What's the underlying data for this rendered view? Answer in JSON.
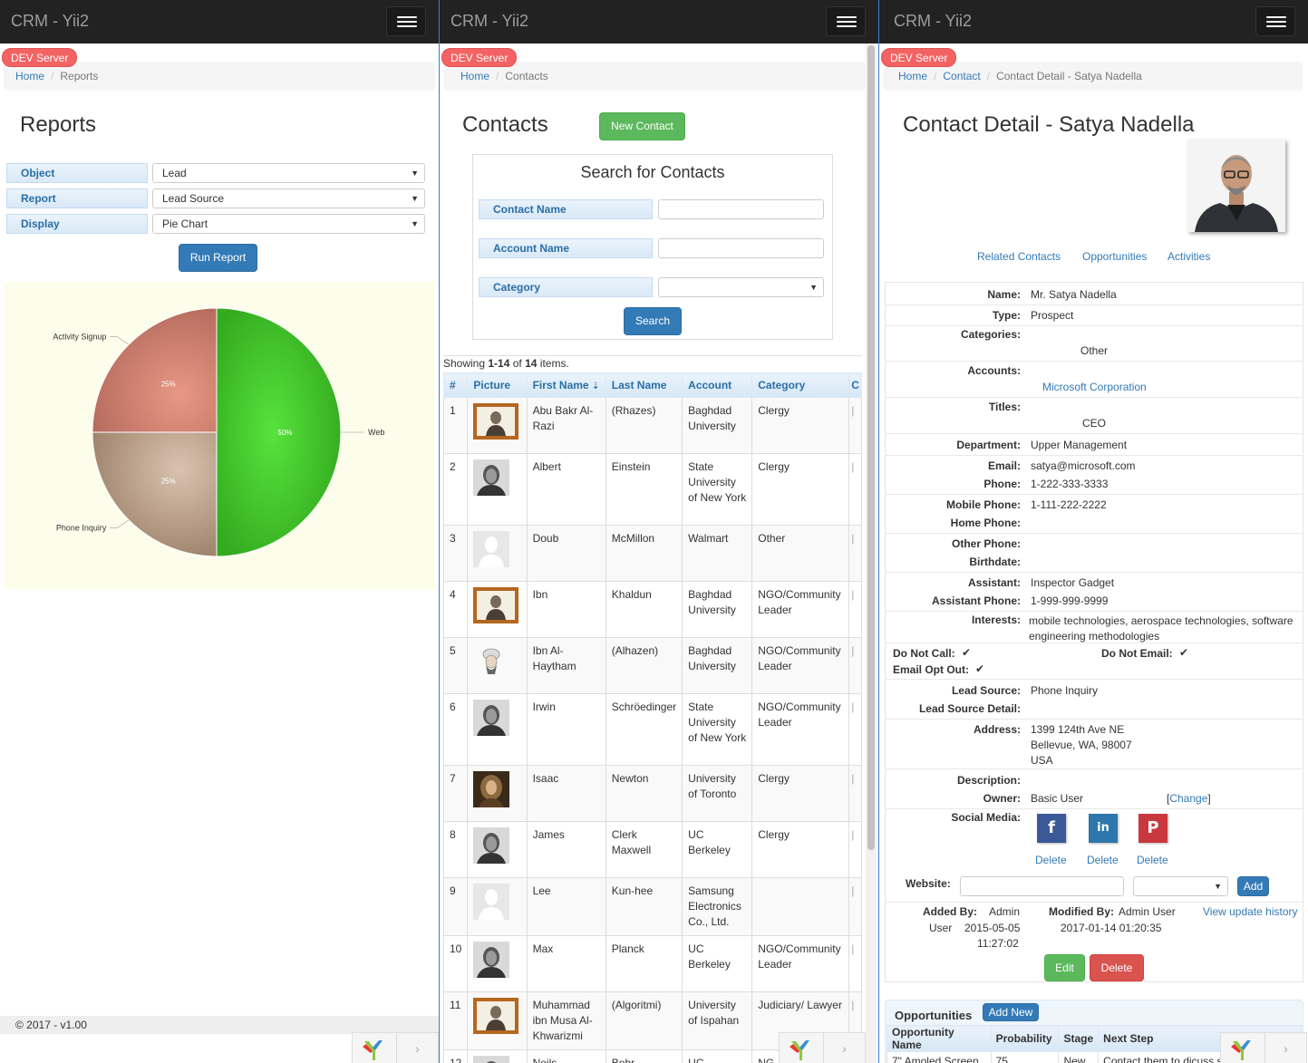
{
  "app_title": "CRM - Yii2",
  "dev_badge": "DEV  Server",
  "reports": {
    "breadcrumb": {
      "home": "Home",
      "current": "Reports"
    },
    "title": "Reports",
    "filters": [
      {
        "label": "Object",
        "value": "Lead"
      },
      {
        "label": "Report",
        "value": "Lead Source"
      },
      {
        "label": "Display",
        "value": "Pie Chart"
      }
    ],
    "run_button": "Run Report",
    "footer": "© 2017 - v1.00"
  },
  "chart_data": {
    "type": "pie",
    "title": "",
    "slices": [
      {
        "label": "Web",
        "value": 50,
        "display": "50%",
        "color": "#3cba2a"
      },
      {
        "label": "Phone Inquiry",
        "value": 25,
        "display": "25%",
        "color": "#b49c85"
      },
      {
        "label": "Activity Signup",
        "value": 25,
        "display": "25%",
        "color": "#c87b69"
      }
    ]
  },
  "contacts": {
    "breadcrumb": {
      "home": "Home",
      "current": "Contacts"
    },
    "title": "Contacts",
    "new_button": "New Contact",
    "search": {
      "title": "Search for Contacts",
      "fields": [
        "Contact Name",
        "Account Name",
        "Category"
      ],
      "button": "Search"
    },
    "summary": {
      "prefix": "Showing ",
      "range": "1-14",
      "mid": " of ",
      "total": "14",
      "suffix": " items."
    },
    "columns": [
      "#",
      "Picture",
      "First Name",
      "Last Name",
      "Account",
      "Category",
      "C"
    ],
    "rows": [
      {
        "num": "1",
        "first": "Abu Bakr Al-Razi",
        "last": "(Rhazes)",
        "account": "Baghdad University",
        "category": "Clergy",
        "pic": "portrait-frame"
      },
      {
        "num": "2",
        "first": "Albert",
        "last": "Einstein",
        "account": "State University of New York",
        "category": "Clergy",
        "pic": "photo"
      },
      {
        "num": "3",
        "first": "Doub",
        "last": "McMillon",
        "account": "Walmart",
        "category": "Other",
        "pic": "placeholder"
      },
      {
        "num": "4",
        "first": "Ibn",
        "last": "Khaldun",
        "account": "Baghdad University",
        "category": "NGO/Community Leader",
        "pic": "portrait-frame"
      },
      {
        "num": "5",
        "first": "Ibn Al-Haytham",
        "last": "(Alhazen)",
        "account": "Baghdad University",
        "category": "NGO/Community Leader",
        "pic": "sketch"
      },
      {
        "num": "6",
        "first": "Irwin",
        "last": "Schröedinger",
        "account": "State University of New York",
        "category": "NGO/Community Leader",
        "pic": "photo"
      },
      {
        "num": "7",
        "first": "Isaac",
        "last": "Newton",
        "account": "University of Toronto",
        "category": "Clergy",
        "pic": "painting"
      },
      {
        "num": "8",
        "first": "James",
        "last": "Clerk Maxwell",
        "account": "UC Berkeley",
        "category": "Clergy",
        "pic": "photo"
      },
      {
        "num": "9",
        "first": "Lee",
        "last": "Kun-hee",
        "account": "Samsung Electronics Co., Ltd.",
        "category": "",
        "pic": "placeholder"
      },
      {
        "num": "10",
        "first": "Max",
        "last": "Planck",
        "account": "UC Berkeley",
        "category": "NGO/Community Leader",
        "pic": "photo"
      },
      {
        "num": "11",
        "first": "Muhammad ibn Musa Al-Khwarizmi",
        "last": "(Algoritmi)",
        "account": "University of Ispahan",
        "category": "Judiciary/ Lawyer",
        "pic": "portrait-frame"
      },
      {
        "num": "12",
        "first": "Neils",
        "last": "Bohr",
        "account": "UC",
        "category": "NG",
        "pic": "photo"
      }
    ]
  },
  "detail": {
    "breadcrumb": {
      "home": "Home",
      "contact": "Contact",
      "current": "Contact Detail - Satya Nadella"
    },
    "title": "Contact Detail - Satya Nadella",
    "tabs": [
      "Related Contacts",
      "Opportunities",
      "Activities"
    ],
    "name_label": "Name:",
    "name": "Mr. Satya Nadella",
    "type_label": "Type:",
    "type": "Prospect",
    "categories_label": "Categories:",
    "categories": "Other",
    "accounts_label": "Accounts:",
    "accounts": "Microsoft Corporation",
    "titles_label": "Titles:",
    "titles": "CEO",
    "department_label": "Department:",
    "department": "Upper Management",
    "email_label": "Email:",
    "email": "satya@microsoft.com",
    "phone_label": "Phone:",
    "phone": "1-222-333-3333",
    "mobile_label": "Mobile Phone:",
    "mobile": "1-111-222-2222",
    "home_phone_label": "Home Phone:",
    "other_phone_label": "Other Phone:",
    "birthdate_label": "Birthdate:",
    "assistant_label": "Assistant:",
    "assistant": "Inspector Gadget",
    "assistant_phone_label": "Assistant Phone:",
    "assistant_phone": "1-999-999-9999",
    "interests_label": "Interests:",
    "interests": "mobile technologies, aerospace technologies, software engineering methodologies",
    "do_not_call_label": "Do Not Call:",
    "do_not_email_label": "Do Not Email:",
    "email_opt_out_label": "Email Opt Out:",
    "check": "✔",
    "lead_source_label": "Lead Source:",
    "lead_source": "Phone Inquiry",
    "lead_source_detail_label": "Lead Source Detail:",
    "address_label": "Address:",
    "address": [
      "1399 124th Ave NE",
      "Bellevue, WA, 98007",
      "USA"
    ],
    "description_label": "Description:",
    "owner_label": "Owner:",
    "owner": "Basic User",
    "change_open": "[",
    "change": "Change",
    "change_close": "]",
    "social_label": "Social Media:",
    "social": [
      {
        "icon": "facebook-icon",
        "glyph": "f",
        "color": "#3b5998",
        "delete": "Delete"
      },
      {
        "icon": "linkedin-icon",
        "glyph": "in",
        "color": "#2d77ac",
        "delete": "Delete"
      },
      {
        "icon": "pinterest-icon",
        "glyph": "P",
        "color": "#c9383f",
        "delete": "Delete"
      }
    ],
    "website_label": "Website:",
    "add_button": "Add",
    "added_by_label": "Added By:",
    "added_by_name1": "Admin",
    "added_by_name2": "User",
    "added_date": "2015-05-05",
    "added_time": "11:27:02",
    "modified_by_label": "Modified By:",
    "modified_by": "Admin User",
    "modified_date": "2017-01-14 01:20:35",
    "history_link": "View update history",
    "edit_button": "Edit",
    "delete_button": "Delete",
    "opportunities": {
      "title": "Opportunities",
      "add_new": "Add New",
      "columns": [
        "Opportunity Name",
        "Probability",
        "Stage",
        "Next Step"
      ],
      "rows": [
        [
          "7\" Amoled Screen",
          "75",
          "New",
          "Contact them to dicuss s"
        ]
      ]
    }
  }
}
